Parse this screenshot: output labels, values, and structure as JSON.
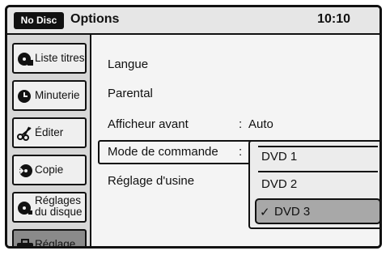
{
  "status": {
    "disc_badge": "No Disc",
    "title": "Options",
    "clock": "10:10"
  },
  "sidebar": {
    "items": [
      {
        "label": "Liste titres",
        "icon": "disc-list-icon"
      },
      {
        "label": "Minuterie",
        "icon": "clock-icon"
      },
      {
        "label": "Éditer",
        "icon": "scissors-icon"
      },
      {
        "label": "Copie",
        "icon": "copy-disc-icon"
      },
      {
        "label": "Réglages du disque",
        "icon": "disc-settings-icon"
      },
      {
        "label": "Réglage",
        "icon": "toolbox-icon",
        "active": true
      }
    ]
  },
  "settings": {
    "rows": [
      {
        "label": "Langue"
      },
      {
        "label": "Parental"
      },
      {
        "label": "Afficheur avant",
        "value": "Auto"
      },
      {
        "label": "Mode de commande",
        "value": ""
      },
      {
        "label": "Réglage d'usine"
      }
    ]
  },
  "dropdown": {
    "options": [
      "DVD 1",
      "DVD 2",
      "DVD 3"
    ],
    "selected": "DVD 3",
    "check_mark": "✓"
  },
  "colors": {
    "active_bg": "#8a8a8a",
    "highlight_bg": "#a8a8a8"
  }
}
